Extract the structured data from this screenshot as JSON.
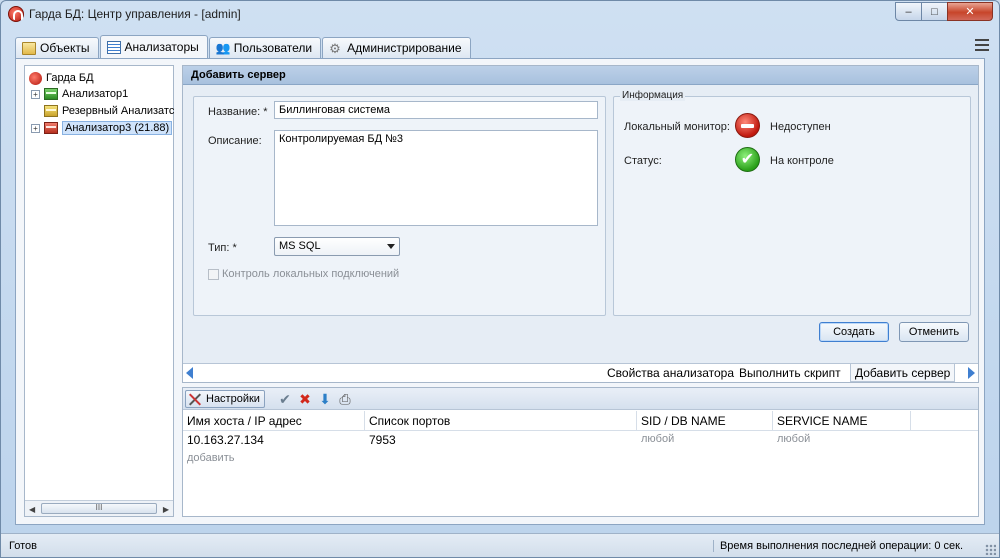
{
  "window": {
    "title": "Гарда БД: Центр управления - [admin]",
    "controls": {
      "minimize": "–",
      "maximize": "□",
      "close": "✕"
    }
  },
  "tabs": [
    {
      "label": "Объекты",
      "icon": "folder-icon"
    },
    {
      "label": "Анализаторы",
      "icon": "analyzers-icon",
      "active": true
    },
    {
      "label": "Пользователи",
      "icon": "users-icon"
    },
    {
      "label": "Администрирование",
      "icon": "gear-icon"
    }
  ],
  "tree": {
    "root": "Гарда БД",
    "items": [
      {
        "label": "Анализатор1",
        "status": "green"
      },
      {
        "label": "Резервный Анализатс",
        "status": "yellow"
      },
      {
        "label": "Анализатор3 (21.88)",
        "status": "red",
        "selected": true
      }
    ],
    "scroll_thumb": "III"
  },
  "panel": {
    "header": "Добавить сервер",
    "form": {
      "name_label": "Название: *",
      "name_value": "Биллинговая система",
      "desc_label": "Описание:",
      "desc_value": "Контролируемая БД №3",
      "type_label": "Тип: *",
      "type_value": "MS SQL",
      "local_check_label": "Контроль локальных подключений"
    },
    "info": {
      "legend": "Информация",
      "monitor_label": "Локальный монитор:",
      "monitor_value": "Недоступен",
      "status_label": "Статус:",
      "status_value": "На контроле"
    },
    "buttons": {
      "create": "Создать",
      "cancel": "Отменить"
    },
    "bottom_tabs": [
      "Свойства анализатора",
      "Выполнить скрипт",
      "Добавить сервер"
    ]
  },
  "lower": {
    "settings_label": "Настройки",
    "columns": [
      "Имя хоста / IP адрес",
      "Список портов",
      "SID / DB NAME",
      "SERVICE NAME"
    ],
    "rows": [
      {
        "host": "10.163.27.134",
        "ports": "7953",
        "sid": "любой",
        "service": "любой"
      }
    ],
    "add_label": "добавить"
  },
  "statusbar": {
    "left": "Готов",
    "right": "Время выполнения последней операции: 0 сек."
  },
  "colors": {
    "accent": "#3f7fd0",
    "ok": "#2aa019",
    "error": "#c0180e"
  }
}
